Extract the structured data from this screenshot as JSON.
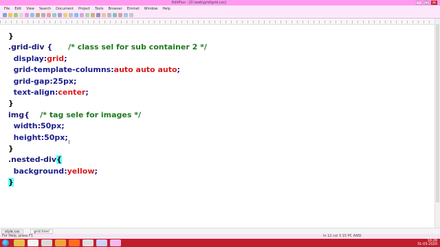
{
  "window": {
    "title": "EditPlus - [D:\\web\\grid\\grid.css]"
  },
  "menu": [
    "File",
    "Edit",
    "View",
    "Search",
    "Document",
    "Project",
    "Tools",
    "Browser",
    "Emmet",
    "Window",
    "Help"
  ],
  "code_lines": [
    {
      "parts": [
        {
          "t": "}",
          "c": "brace"
        }
      ]
    },
    {
      "parts": [
        {
          "t": ".grid-div {",
          "c": "sel"
        },
        {
          "t": "      /* class sel for sub container 2 */",
          "c": "cmt"
        }
      ]
    },
    {
      "parts": [
        {
          "t": "  display",
          "c": "prop"
        },
        {
          "t": ":",
          "c": "colon"
        },
        {
          "t": "grid",
          "c": "val"
        },
        {
          "t": ";",
          "c": "semi"
        }
      ]
    },
    {
      "parts": [
        {
          "t": "  grid-template-columns",
          "c": "prop"
        },
        {
          "t": ":",
          "c": "colon"
        },
        {
          "t": "auto auto auto",
          "c": "val"
        },
        {
          "t": ";",
          "c": "semi"
        }
      ]
    },
    {
      "parts": [
        {
          "t": "  grid-gap",
          "c": "prop"
        },
        {
          "t": ":25px;",
          "c": "prop"
        }
      ]
    },
    {
      "parts": [
        {
          "t": "  text-align",
          "c": "prop"
        },
        {
          "t": ":",
          "c": "colon"
        },
        {
          "t": "center",
          "c": "val"
        },
        {
          "t": ";",
          "c": "semi"
        }
      ]
    },
    {
      "parts": [
        {
          "t": "}",
          "c": "brace"
        }
      ]
    },
    {
      "parts": [
        {
          "t": "img{",
          "c": "sel"
        },
        {
          "t": "    /* tag sele for images */",
          "c": "cmt"
        }
      ]
    },
    {
      "parts": [
        {
          "t": "  width",
          "c": "prop"
        },
        {
          "t": ":50px;",
          "c": "prop"
        }
      ]
    },
    {
      "parts": [
        {
          "t": "  height",
          "c": "prop"
        },
        {
          "t": ":50px;",
          "c": "prop"
        }
      ]
    },
    {
      "parts": [
        {
          "t": "}",
          "c": "brace"
        }
      ]
    },
    {
      "parts": [
        {
          "t": ".nested-div",
          "c": "sel"
        },
        {
          "t": "{",
          "c": "brace hl"
        }
      ]
    },
    {
      "parts": [
        {
          "t": "  background",
          "c": "prop"
        },
        {
          "t": ":",
          "c": "colon"
        },
        {
          "t": "yellow",
          "c": "val"
        },
        {
          "t": ";",
          "c": "semi"
        }
      ]
    },
    {
      "parts": [
        {
          "t": "}",
          "c": "brace hl"
        }
      ]
    }
  ],
  "tabs": [
    "style.css",
    "grid.html"
  ],
  "status": {
    "left": "For Help, press F1",
    "position": "In 12  col 3  15  PC  ANSI"
  },
  "clock": {
    "time": "10:28",
    "date": "31-03-2020"
  },
  "colors": {
    "titlebar": "#ff9af0",
    "taskbar": "#bf1f2a",
    "comment": "#1f7a1f",
    "value": "#d71a1a",
    "property": "#1c1c8c",
    "brace_highlight": "#66ffff"
  }
}
